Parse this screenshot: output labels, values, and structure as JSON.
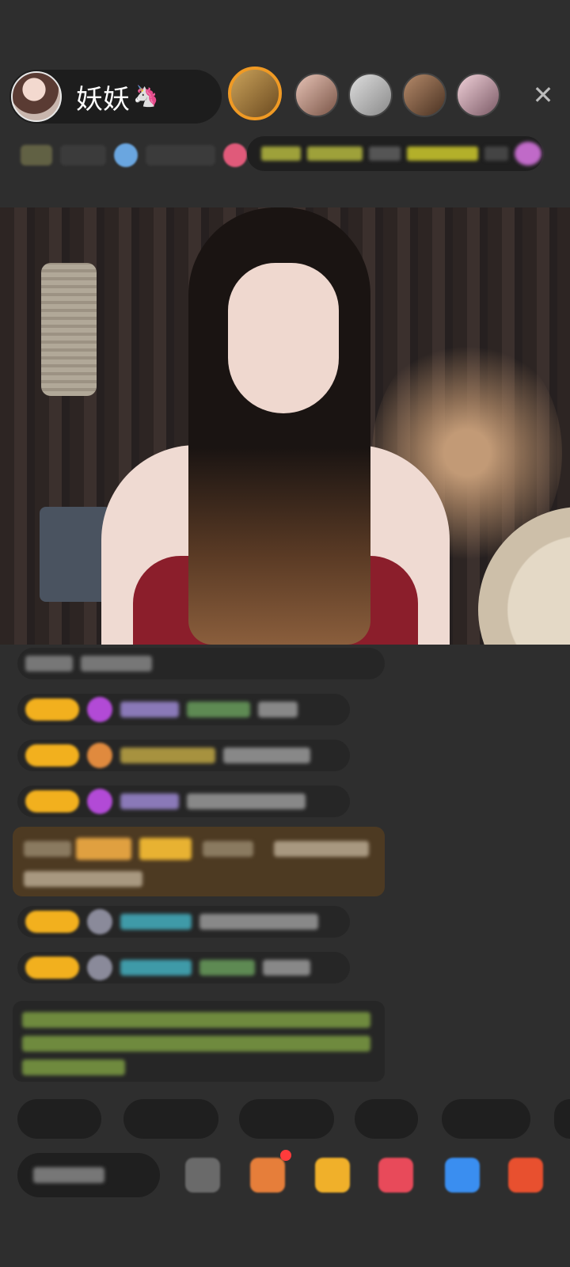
{
  "header": {
    "host_name": "妖妖",
    "host_emoji": "🦄",
    "close_icon": "close-icon"
  },
  "colors": {
    "background": "#2e2e2e",
    "pill": "#1d1d1d",
    "level_badge": "#f2b01e",
    "gift_card": "#4d3a22",
    "viewer_highlight": "#f09a24"
  }
}
